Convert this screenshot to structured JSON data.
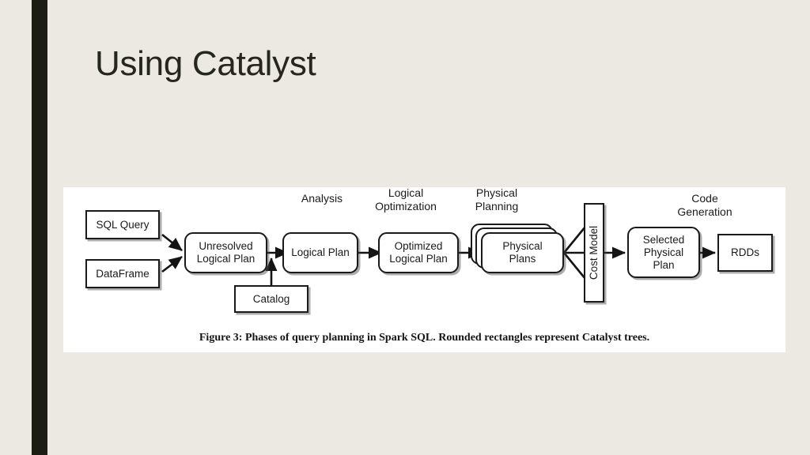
{
  "slide": {
    "title": "Using Catalyst",
    "background_color": "#ece9e2",
    "accent_bar_color": "#1d1e13"
  },
  "figure": {
    "caption": "Figure 3: Phases of query planning in Spark SQL. Rounded rectangles represent Catalyst trees.",
    "panel_color": "#ffffff",
    "phases": [
      {
        "name": "analysis",
        "label": "Analysis"
      },
      {
        "name": "logical-optimization",
        "label": "Logical\nOptimization"
      },
      {
        "name": "physical-planning",
        "label": "Physical\nPlanning"
      },
      {
        "name": "code-generation",
        "label": "Code\nGeneration"
      }
    ],
    "nodes": [
      {
        "name": "sql-query",
        "label": "SQL Query",
        "shape": "rectangle"
      },
      {
        "name": "dataframe",
        "label": "DataFrame",
        "shape": "rectangle"
      },
      {
        "name": "unresolved-logical-plan",
        "label": "Unresolved\nLogical Plan",
        "shape": "rounded"
      },
      {
        "name": "catalog",
        "label": "Catalog",
        "shape": "rectangle"
      },
      {
        "name": "logical-plan",
        "label": "Logical Plan",
        "shape": "rounded"
      },
      {
        "name": "optimized-logical-plan",
        "label": "Optimized\nLogical Plan",
        "shape": "rounded"
      },
      {
        "name": "physical-plans",
        "label": "Physical\nPlans",
        "shape": "rounded-stack"
      },
      {
        "name": "cost-model",
        "label": "Cost Model",
        "shape": "rectangle-vertical"
      },
      {
        "name": "selected-physical-plan",
        "label": "Selected\nPhysical\nPlan",
        "shape": "rounded"
      },
      {
        "name": "rdds",
        "label": "RDDs",
        "shape": "rectangle"
      }
    ]
  }
}
